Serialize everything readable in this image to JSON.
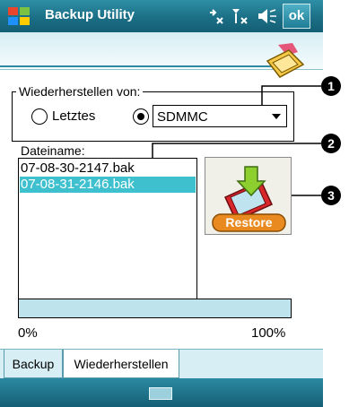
{
  "titlebar": {
    "app_title": "Backup Utility",
    "ok_label": "ok",
    "icons": [
      "windows-start-icon",
      "connectivity-icon",
      "signal-icon",
      "volume-icon"
    ]
  },
  "restore_from": {
    "legend": "Wiederherstellen von:",
    "option_last": "Letztes",
    "option_last_selected": false,
    "option_device_selected": true,
    "device_value": "SDMMC"
  },
  "file_list": {
    "label": "Dateiname:",
    "items": [
      "07-08-30-2147.bak",
      "07-08-31-2146.bak"
    ],
    "selected_index": 1
  },
  "restore_button": {
    "label": "Restore"
  },
  "callouts": [
    "1",
    "2",
    "3"
  ],
  "progress": {
    "value_percent": 0,
    "min_label": "0%",
    "max_label": "100%"
  },
  "tabs": [
    {
      "label": "Backup",
      "active": false
    },
    {
      "label": "Wiederherstellen",
      "active": true
    }
  ],
  "colors": {
    "titlebar": "#1b6f86",
    "selection": "#3fc0cf",
    "progress_track": "#bfe3ec"
  }
}
